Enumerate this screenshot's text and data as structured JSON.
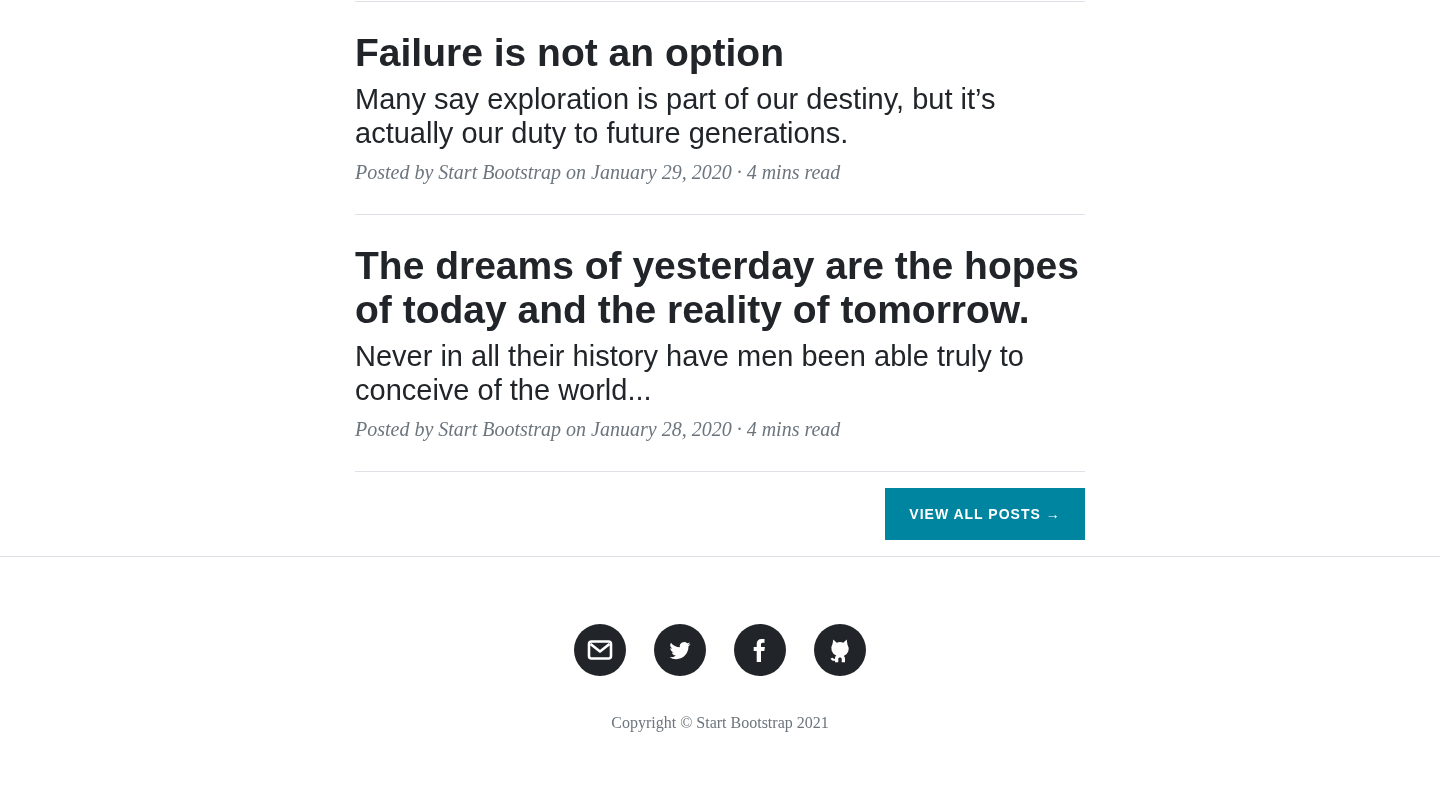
{
  "posts": [
    {
      "title": "Failure is not an option",
      "subtitle": "Many say exploration is part of our destiny, but it’s actually our duty to future generations.",
      "meta": "Posted by Start Bootstrap on January 29, 2020 · 4 mins read"
    },
    {
      "title": "The dreams of yesterday are the hopes of today and the reality of tomorrow.",
      "subtitle": "Never in all their history have men been able truly to conceive of the world...",
      "meta": "Posted by Start Bootstrap on January 28, 2020 · 4 mins read"
    }
  ],
  "pager": {
    "button": "VIEW ALL POSTS →"
  },
  "footer": {
    "social": [
      {
        "kind": "email"
      },
      {
        "kind": "twitter"
      },
      {
        "kind": "facebook"
      },
      {
        "kind": "github"
      }
    ],
    "copyright": "Copyright © Start Bootstrap 2021"
  }
}
